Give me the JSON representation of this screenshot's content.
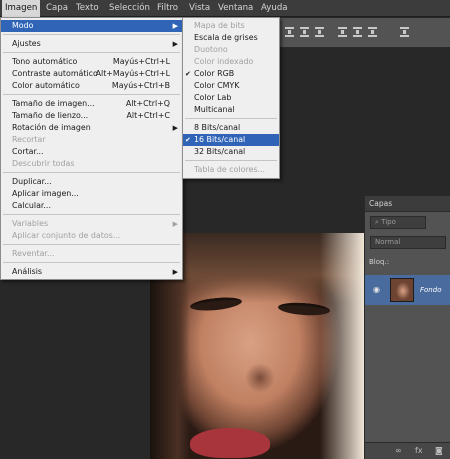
{
  "menubar": {
    "items": [
      {
        "label": "Imagen",
        "active": true
      },
      {
        "label": "Capa"
      },
      {
        "label": "Texto"
      },
      {
        "label": "Selección"
      },
      {
        "label": "Filtro"
      },
      {
        "label": "Vista"
      },
      {
        "label": "Ventana"
      },
      {
        "label": "Ayuda"
      }
    ]
  },
  "image_menu": {
    "items": [
      {
        "label": "Modo",
        "shortcut": "",
        "submenu": true,
        "selected": true
      },
      {
        "label": "Ajustes",
        "shortcut": "",
        "submenu": true
      },
      {
        "label": "Tono automático",
        "shortcut": "Mayús+Ctrl+L"
      },
      {
        "label": "Contraste automático",
        "shortcut": "Alt+Mayús+Ctrl+L"
      },
      {
        "label": "Color automático",
        "shortcut": "Mayús+Ctrl+B"
      },
      {
        "label": "Tamaño de imagen...",
        "shortcut": "Alt+Ctrl+Q"
      },
      {
        "label": "Tamaño de lienzo...",
        "shortcut": "Alt+Ctrl+C"
      },
      {
        "label": "Rotación de imagen",
        "shortcut": "",
        "submenu": true
      },
      {
        "label": "Recortar",
        "shortcut": "",
        "disabled": true
      },
      {
        "label": "Cortar...",
        "shortcut": ""
      },
      {
        "label": "Descubrir todas",
        "shortcut": "",
        "disabled": true
      },
      {
        "label": "Duplicar...",
        "shortcut": ""
      },
      {
        "label": "Aplicar imagen...",
        "shortcut": ""
      },
      {
        "label": "Calcular...",
        "shortcut": ""
      },
      {
        "label": "Variables",
        "shortcut": "",
        "submenu": true,
        "disabled": true
      },
      {
        "label": "Aplicar conjunto de datos...",
        "shortcut": "",
        "disabled": true
      },
      {
        "label": "Reventar...",
        "shortcut": "",
        "disabled": true
      },
      {
        "label": "Análisis",
        "shortcut": "",
        "submenu": true
      }
    ]
  },
  "mode_submenu": {
    "items": [
      {
        "label": "Mapa de bits",
        "disabled": true
      },
      {
        "label": "Escala de grises"
      },
      {
        "label": "Duotono",
        "disabled": true
      },
      {
        "label": "Color indexado",
        "disabled": true
      },
      {
        "label": "Color RGB",
        "checked": true
      },
      {
        "label": "Color CMYK"
      },
      {
        "label": "Color Lab"
      },
      {
        "label": "Multicanal"
      },
      {
        "label": "8 Bits/canal"
      },
      {
        "label": "16 Bits/canal",
        "checked": true,
        "selected": true
      },
      {
        "label": "32 Bits/canal"
      },
      {
        "label": "Tabla de colores...",
        "disabled": true
      }
    ]
  },
  "layers_panel": {
    "tab": "Capas",
    "filter": "Tipo",
    "blend_mode": "Normal",
    "lock_label": "Bloq.:",
    "layer_name": "Fondo"
  },
  "icons": {
    "checkmark": "✔",
    "submenu_arrow": "▶",
    "eye": "👁",
    "link": "∞",
    "fx": "fx"
  },
  "colors": {
    "highlight": "#3064b6",
    "menu_bg": "#efefef",
    "layer_selected": "#4a6b9e"
  }
}
